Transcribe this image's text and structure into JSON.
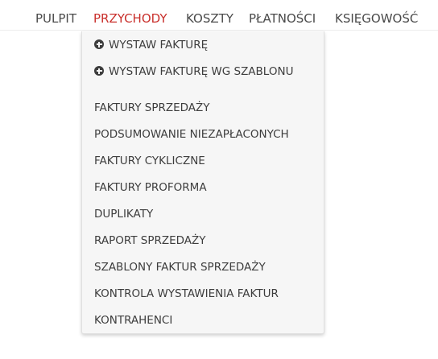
{
  "nav": {
    "items": [
      {
        "label": "PULPIT"
      },
      {
        "label": "PRZYCHODY"
      },
      {
        "label": "KOSZTY"
      },
      {
        "label": "PŁATNOŚCI"
      },
      {
        "label": "KSIĘGOWOŚĆ"
      }
    ],
    "active_color": "#c9302c",
    "text_color": "#4a4a4a"
  },
  "dropdown": {
    "actions": [
      {
        "label": "WYSTAW FAKTURĘ",
        "icon": "plus-circle-icon"
      },
      {
        "label": "WYSTAW FAKTURĘ WG SZABLONU",
        "icon": "plus-circle-icon"
      }
    ],
    "items": [
      {
        "label": "FAKTURY SPRZEDAŻY"
      },
      {
        "label": "PODSUMOWANIE NIEZAPŁACONYCH"
      },
      {
        "label": "FAKTURY CYKLICZNE"
      },
      {
        "label": "FAKTURY PROFORMA"
      },
      {
        "label": "DUPLIKATY"
      },
      {
        "label": "RAPORT SPRZEDAŻY"
      },
      {
        "label": "SZABLONY FAKTUR SPRZEDAŻY"
      },
      {
        "label": "KONTROLA WYSTAWIENIA FAKTUR"
      },
      {
        "label": "KONTRAHENCI"
      }
    ]
  }
}
